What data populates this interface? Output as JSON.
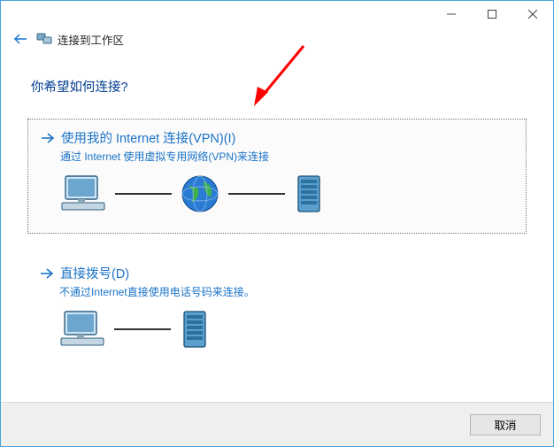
{
  "window": {
    "breadcrumb": "连接到工作区"
  },
  "question": "你希望如何连接?",
  "options": {
    "vpn": {
      "title": "使用我的 Internet 连接(VPN)(I)",
      "desc": "通过 Internet 使用虚拟专用网络(VPN)来连接"
    },
    "dial": {
      "title": "直接拨号(D)",
      "desc": "不通过Internet直接使用电话号码来连接。"
    }
  },
  "footer": {
    "cancel": "取消"
  }
}
